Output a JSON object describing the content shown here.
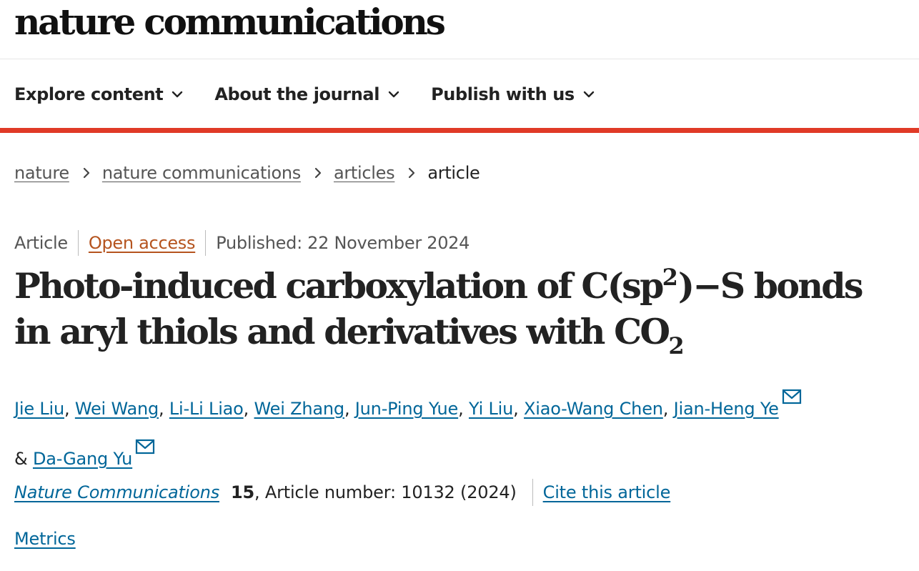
{
  "header": {
    "logo_text": "nature communications"
  },
  "nav": {
    "items": [
      {
        "label": "Explore content",
        "icon": "chevron-down-icon"
      },
      {
        "label": "About the journal",
        "icon": "chevron-down-icon"
      },
      {
        "label": "Publish with us",
        "icon": "chevron-down-icon"
      }
    ]
  },
  "colors": {
    "accent_bar": "#e03a27",
    "link": "#006699",
    "open_access": "#b5541f"
  },
  "breadcrumb": {
    "items": [
      "nature",
      "nature communications",
      "articles"
    ],
    "current": "article"
  },
  "meta": {
    "type": "Article",
    "access": "Open access",
    "published": "Published: 22 November 2024"
  },
  "title": {
    "part1": "Photo-induced carboxylation of C(sp",
    "sup": "2",
    "part2": ")−S bonds in aryl thiols and derivatives with CO",
    "sub": "2"
  },
  "authors": {
    "names": [
      "Jie Liu",
      "Wei Wang",
      "Li-Li Liao",
      "Wei Zhang",
      "Jun-Ping Yue",
      "Yi Liu",
      "Xiao-Wang Chen",
      "Jian-Heng Ye",
      "Da-Gang Yu"
    ],
    "separator": ", ",
    "conjunction": "& ",
    "corresponding": [
      "Jian-Heng Ye",
      "Da-Gang Yu"
    ]
  },
  "citation": {
    "journal": "Nature Communications",
    "volume": "15",
    "details": ", Article number: 10132 (2024)",
    "cite_label": "Cite this article"
  },
  "metrics": {
    "label": "Metrics"
  }
}
